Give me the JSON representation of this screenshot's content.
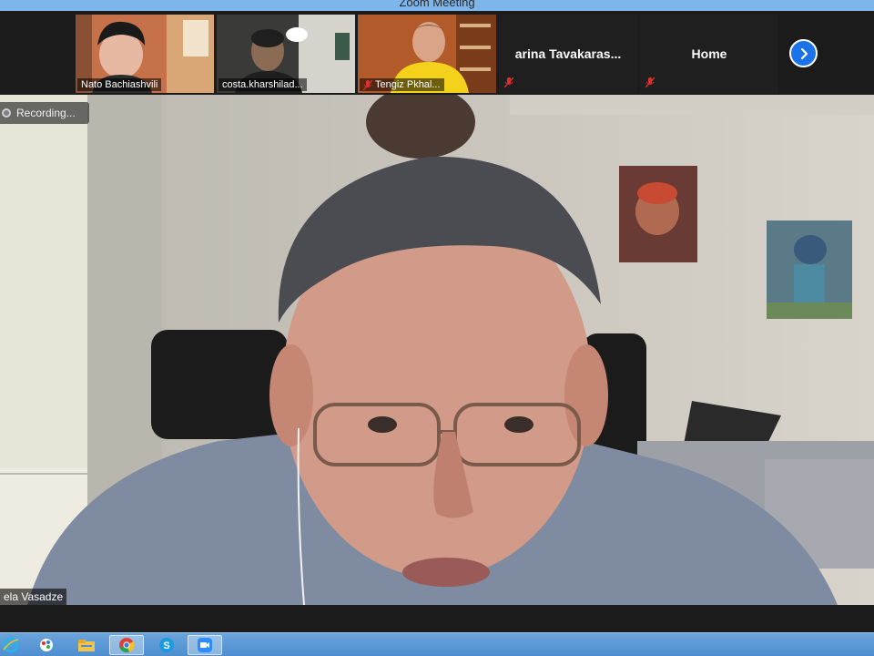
{
  "window": {
    "title": "Zoom Meeting"
  },
  "gallery": {
    "video_tiles": [
      {
        "name": "Nato Bachiashvili",
        "muted": false
      },
      {
        "name": "costa.kharshilad...",
        "muted": false
      },
      {
        "name": "Tengiz Pkhal...",
        "muted": true
      }
    ],
    "name_tiles": [
      {
        "name": "arina  Tavakaras...",
        "muted": true
      },
      {
        "name": "Home",
        "muted": true
      }
    ],
    "next_page_icon": "chevron-right-icon"
  },
  "recording": {
    "label": "Recording..."
  },
  "active_speaker": {
    "name": "ela Vasadze"
  },
  "taskbar": {
    "items": [
      {
        "icon": "internet-explorer-icon",
        "active": false
      },
      {
        "icon": "paint-icon",
        "active": false
      },
      {
        "icon": "file-explorer-icon",
        "active": false
      },
      {
        "icon": "chrome-icon",
        "active": true
      },
      {
        "icon": "skype-icon",
        "active": false
      },
      {
        "icon": "zoom-icon",
        "active": true
      }
    ]
  },
  "colors": {
    "titlebar": "#7eb6ec",
    "accent": "#1a73e8",
    "mute_red": "#e0302c",
    "taskbar": "#5a98d6"
  }
}
